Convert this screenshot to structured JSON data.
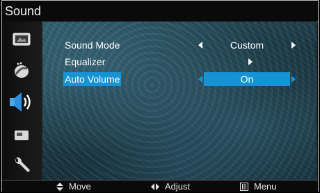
{
  "window": {
    "title": "Sound"
  },
  "sidebar": {
    "items": [
      {
        "icon": "picture-icon",
        "active": false
      },
      {
        "icon": "color-ball-icon",
        "active": false
      },
      {
        "icon": "speaker-icon",
        "active": true
      },
      {
        "icon": "channel-icon",
        "active": false
      },
      {
        "icon": "wrench-icon",
        "active": false
      }
    ]
  },
  "menu": {
    "items": [
      {
        "label": "Sound Mode",
        "value": "Custom"
      },
      {
        "label": "Equalizer",
        "value": ""
      },
      {
        "label": "Auto Volume",
        "value": "On",
        "selected": true
      }
    ]
  },
  "statusbar": {
    "move": "Move",
    "adjust": "Adjust",
    "menu": "Menu"
  },
  "colors": {
    "highlight": "#1593d4",
    "background": "#1b1b1b"
  }
}
